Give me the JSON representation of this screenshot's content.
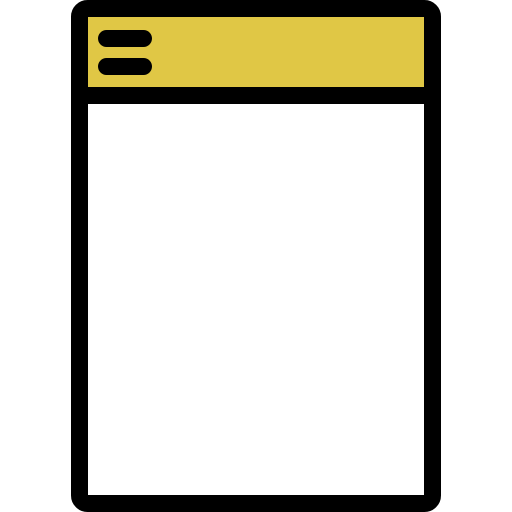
{
  "icon": {
    "name": "window-document-icon",
    "colors": {
      "outline": "#000000",
      "header_fill": "#E0C745",
      "body_fill": "#FFFFFF",
      "background": "#FFFFFF"
    },
    "header": {
      "menu_icon": "hamburger-menu-icon",
      "menu_lines": 2
    }
  }
}
